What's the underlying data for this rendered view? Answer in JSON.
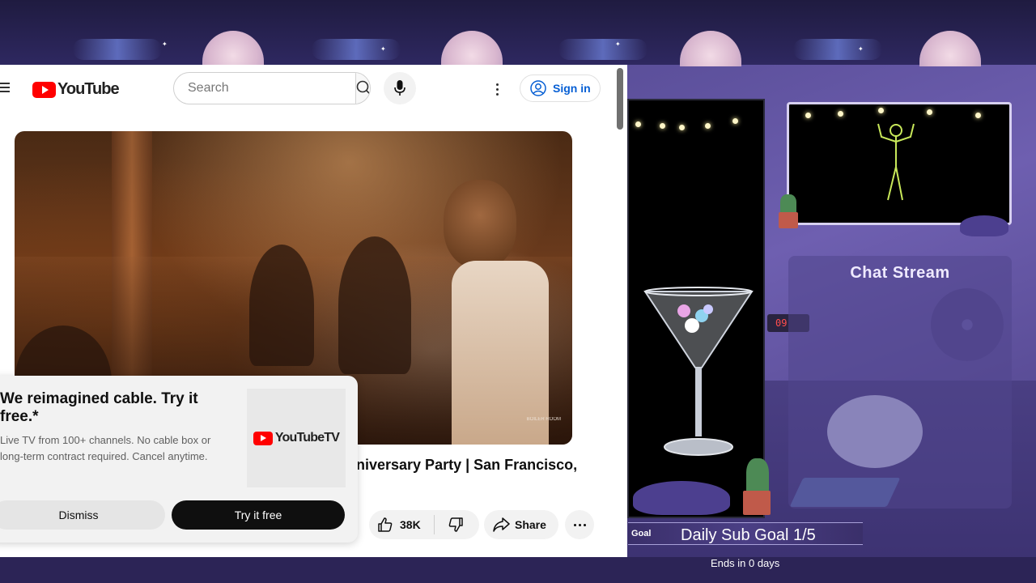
{
  "youtube": {
    "logo_text": "YouTube",
    "search": {
      "placeholder": "Search"
    },
    "sign_in_label": "Sign in",
    "video": {
      "title": "niversary Party | San Francisco,",
      "watermark": "BOILER ROOM",
      "likes": "38K",
      "share_label": "Share"
    },
    "promo": {
      "title": "We reimagined cable. Try it free.*",
      "description": "Live TV from 100+ channels. No cable box or long-term contract required. Cancel anytime.",
      "logo_text": "YouTubeTV",
      "dismiss_label": "Dismiss",
      "try_label": "Try it free"
    }
  },
  "overlay": {
    "chat_title": "Chat Stream",
    "goal": {
      "label": "Goal",
      "title": "Daily Sub Goal 1/5",
      "ends": "Ends in 0 days"
    },
    "clock": "09"
  },
  "colors": {
    "youtube_red": "#ff0000",
    "link_blue": "#065fd4",
    "overlay_purple": "#4b3f85"
  },
  "icons": [
    "menu-icon",
    "search-icon",
    "microphone-icon",
    "more-vert-icon",
    "account-icon",
    "thumb-up-icon",
    "thumb-down-icon",
    "share-icon",
    "more-horiz-icon"
  ]
}
